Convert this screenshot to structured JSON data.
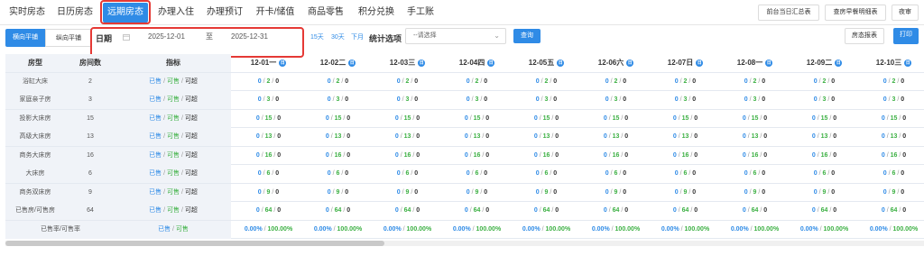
{
  "tabs": [
    {
      "label": "实时房态",
      "active": false
    },
    {
      "label": "日历房态",
      "active": false
    },
    {
      "label": "远期房态",
      "active": true
    },
    {
      "label": "办理入住",
      "active": false
    },
    {
      "label": "办理预订",
      "active": false
    },
    {
      "label": "开卡/储值",
      "active": false
    },
    {
      "label": "商品零售",
      "active": false
    },
    {
      "label": "积分兑换",
      "active": false
    },
    {
      "label": "手工账",
      "active": false
    }
  ],
  "top_buttons": {
    "summary": "前台当日汇总表",
    "breakfast": "查房早餐明细表",
    "night_audit": "夜审"
  },
  "toolbar": {
    "seg_horizontal": "横向平铺",
    "seg_vertical": "纵向平铺",
    "date_label": "日期",
    "date_from": "2025-12-01",
    "date_sep": "至",
    "date_to": "2025-12-31",
    "quick_15": "15天",
    "quick_30": "30天",
    "quick_next": "下月",
    "stats_label": "统计选项",
    "stats_placeholder": "--请选择",
    "query": "查询",
    "room_report": "房态报表",
    "print": "打印"
  },
  "colors": {
    "accent": "#2f8be6",
    "highlight": "#e53935",
    "available": "#3cb043"
  },
  "table": {
    "headers": {
      "room_type": "房型",
      "room_count": "房间数",
      "indicator": "指标"
    },
    "dates": [
      "12-01一",
      "12-02二",
      "12-03三",
      "12-04四",
      "12-05五",
      "12-06六",
      "12-07日",
      "12-08一",
      "12-09二",
      "12-10三"
    ],
    "date_icon": "calendar-badge-icon",
    "indicator_text": {
      "sold": "已售",
      "sep1": " / ",
      "avail": "可售",
      "sep2": " / ",
      "over": "可超"
    },
    "rows": [
      {
        "name": "浴缸大床",
        "count": "2",
        "cells": [
          "0",
          "2",
          "0"
        ]
      },
      {
        "name": "家庭亲子房",
        "count": "3",
        "cells": [
          "0",
          "3",
          "0"
        ]
      },
      {
        "name": "投影大床房",
        "count": "15",
        "cells": [
          "0",
          "15",
          "0"
        ]
      },
      {
        "name": "高级大床房",
        "count": "13",
        "cells": [
          "0",
          "13",
          "0"
        ]
      },
      {
        "name": "商务大床房",
        "count": "16",
        "cells": [
          "0",
          "16",
          "0"
        ]
      },
      {
        "name": "大床房",
        "count": "6",
        "cells": [
          "0",
          "6",
          "0"
        ]
      },
      {
        "name": "商务双床房",
        "count": "9",
        "cells": [
          "0",
          "9",
          "0"
        ]
      },
      {
        "name": "已售房/可售房",
        "count": "64",
        "cells": [
          "0",
          "64",
          "0"
        ]
      }
    ],
    "footer": {
      "name": "已售率/可售率",
      "indicator_sold": "已售",
      "indicator_sep": " / ",
      "indicator_avail": "可售",
      "rate_sold": "0.00%",
      "rate_sep": " / ",
      "rate_avail": "100.00%"
    }
  }
}
